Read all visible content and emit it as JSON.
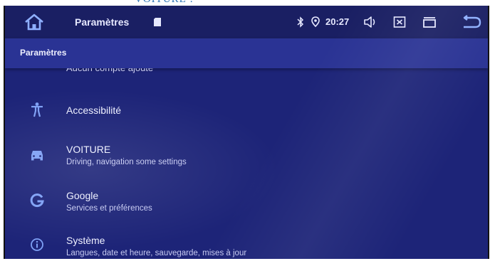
{
  "caption": {
    "text": "VOITURE :"
  },
  "status_bar": {
    "title": "Paramètres",
    "time": "20:27"
  },
  "app_bar": {
    "title": "Paramètres"
  },
  "partial_item": {
    "label": "Aucun compte ajouté"
  },
  "settings": [
    {
      "title": "Accessibilité",
      "subtitle": "",
      "icon": "accessibility-icon"
    },
    {
      "title": "VOITURE",
      "subtitle": "Driving, navigation some settings",
      "icon": "car-icon"
    },
    {
      "title": "Google",
      "subtitle": "Services et préférences",
      "icon": "google-icon"
    },
    {
      "title": "Système",
      "subtitle": "Langues, date et heure, sauvegarde, mises à jour",
      "icon": "info-icon"
    }
  ],
  "colors": {
    "background": "#1d2478",
    "status_bar": "#1a1f63",
    "app_bar": "#2a3394",
    "text": "#eef0ff",
    "caption": "#2e74b5"
  }
}
